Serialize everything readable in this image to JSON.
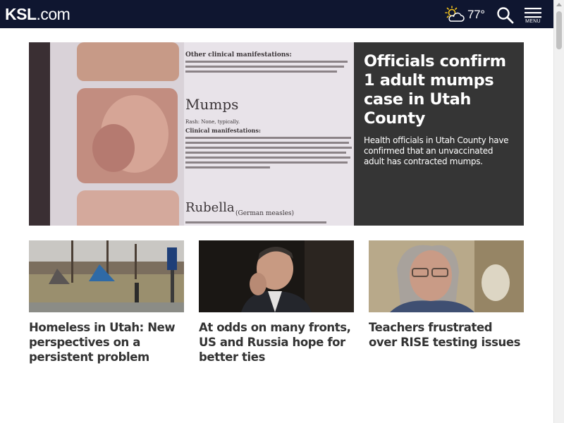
{
  "header": {
    "logo_ksl": "KSL",
    "logo_com": ".com",
    "weather": {
      "temperature": "77°",
      "icon": "partly-cloudy-icon"
    },
    "search_icon": "search-icon",
    "menu_label": "MENU",
    "bg_color": "#0f1630"
  },
  "hero": {
    "title": "Officials confirm 1 adult mumps case in Utah County",
    "description": "Health officials in Utah County have confirmed that an unvaccinated adult has contracted mumps.",
    "image": {
      "heading_mumps": "Mumps",
      "heading_rubella": "Rubella",
      "rubella_suffix": "(German measles)",
      "rash_line": "Rash: None, typically.",
      "clinical_heading": "Other clinical manifestations:",
      "clinical_line": "Clinical manifestations:"
    },
    "panel_color": "#353535"
  },
  "stories": [
    {
      "title": "Homeless in Utah: New perspectives on a persistent problem",
      "image": "homeless-camp-photo"
    },
    {
      "title": "At odds on many fronts, US and Russia hope for better ties",
      "image": "official-photo"
    },
    {
      "title": "Teachers frustrated over RISE testing issues",
      "image": "teacher-interview-photo"
    }
  ]
}
